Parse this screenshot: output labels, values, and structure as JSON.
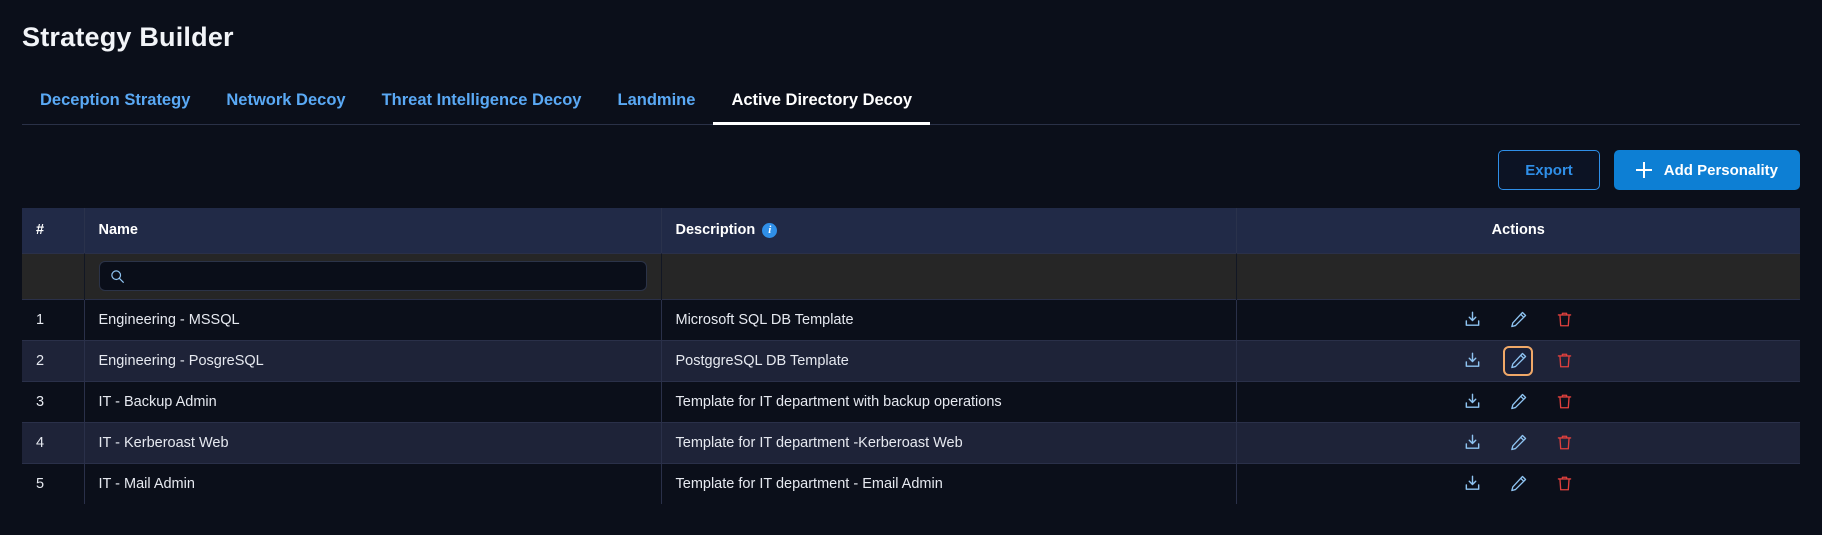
{
  "header": {
    "title": "Strategy Builder"
  },
  "tabs": [
    {
      "label": "Deception Strategy",
      "active": false
    },
    {
      "label": "Network Decoy",
      "active": false
    },
    {
      "label": "Threat Intelligence Decoy",
      "active": false
    },
    {
      "label": "Landmine",
      "active": false
    },
    {
      "label": "Active Directory Decoy",
      "active": true
    }
  ],
  "toolbar": {
    "export_label": "Export",
    "add_label": "Add Personality",
    "add_icon": "plus-icon"
  },
  "table": {
    "columns": [
      {
        "key": "num",
        "label": "#"
      },
      {
        "key": "name",
        "label": "Name"
      },
      {
        "key": "desc",
        "label": "Description",
        "info_icon": "info-icon"
      },
      {
        "key": "actions",
        "label": "Actions"
      }
    ],
    "search": {
      "value": "",
      "placeholder": "",
      "icon": "search-icon"
    },
    "action_icons": [
      "download-icon",
      "edit-icon",
      "delete-icon"
    ],
    "focused_row_index": 1,
    "focused_action": "edit-icon",
    "rows": [
      {
        "num": "1",
        "name": "Engineering - MSSQL",
        "desc": "Microsoft SQL DB Template"
      },
      {
        "num": "2",
        "name": "Engineering - PosgreSQL",
        "desc": "PostggreSQL DB Template"
      },
      {
        "num": "3",
        "name": "IT - Backup Admin",
        "desc": "Template for IT department with backup operations"
      },
      {
        "num": "4",
        "name": "IT - Kerberoast Web",
        "desc": "Template for IT department -Kerberoast Web"
      },
      {
        "num": "5",
        "name": "IT - Mail Admin",
        "desc": "Template for IT department - Email Admin"
      }
    ]
  },
  "colors": {
    "page_background": "#0b0f1a",
    "header_row": "#212a47",
    "row_even": "#1e2338",
    "row_odd": "#0b0f1a",
    "filter_row": "#262626",
    "accent_blue": "#2f8fe8",
    "primary_button": "#0d7fd4",
    "tab_link": "#5aa9f5",
    "delete_red": "#e0403d",
    "focus_orange": "#f0a868"
  }
}
